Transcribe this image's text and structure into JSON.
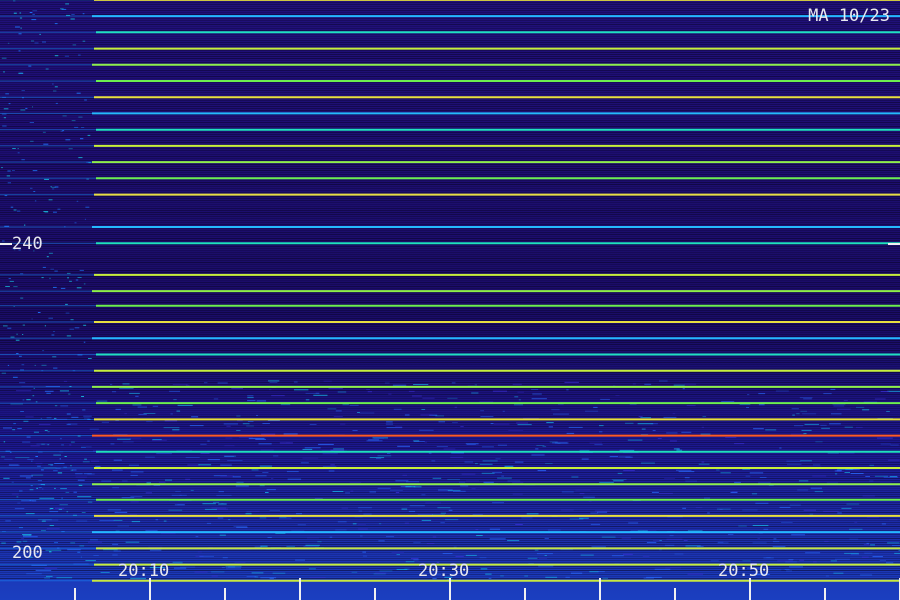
{
  "watermark": "MA 10/23",
  "chart_data": {
    "type": "heatmap",
    "title": "",
    "xlabel": "",
    "ylabel": "",
    "y_ticks": [
      {
        "label": "240",
        "value": 240
      },
      {
        "label": "200",
        "value": 200
      }
    ],
    "x_ticks": [
      {
        "label": "20:10",
        "value": "20:10"
      },
      {
        "label": "20:30",
        "value": "20:30"
      },
      {
        "label": "20:50",
        "value": "20:50"
      }
    ],
    "x_range": [
      "20:05",
      "21:05"
    ],
    "x_minor_tick_minutes": 5,
    "colormap": [
      "#12063a",
      "#2a10a0",
      "#1e6bff",
      "#19e6c8",
      "#b4f03c",
      "#ffd21e",
      "#ff3c1e"
    ],
    "signal_lines_approx_value": [
      283.6,
      281.5,
      279.4,
      277.3,
      275.2,
      273.1,
      271.1,
      269.0,
      266.9,
      264.8,
      262.7,
      260.6,
      258.5,
      256.4,
      254.3,
      252.2,
      250.1,
      248.0,
      246.1,
      244.0,
      239.9,
      237.8,
      233.6,
      231.5,
      229.4,
      227.3,
      225.2,
      223.1,
      221.0,
      218.9,
      216.8,
      214.7,
      212.6,
      210.5,
      208.4,
      206.3,
      204.3,
      202.2,
      201.1
    ]
  }
}
